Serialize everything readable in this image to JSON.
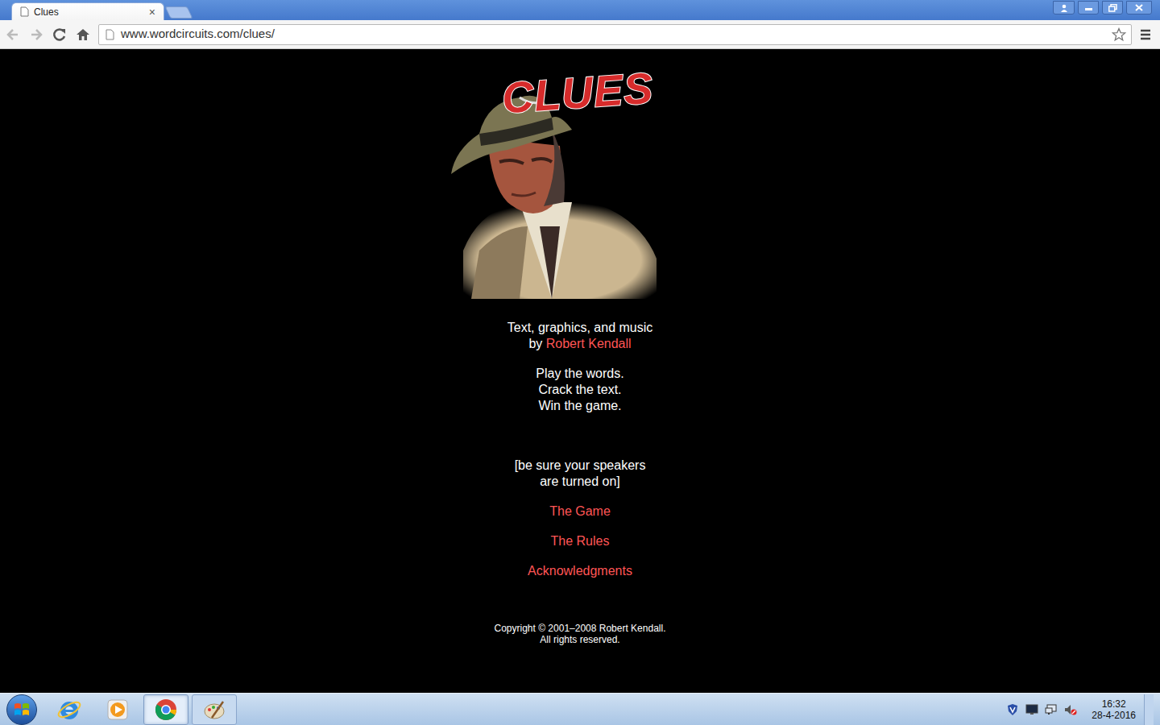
{
  "window": {
    "title": "Clues"
  },
  "browser": {
    "tabs": [
      {
        "label": "Clues",
        "selected": true,
        "close": "×"
      },
      {
        "label": "",
        "selected": false
      }
    ],
    "address": "www.wordcircuits.com/clues/"
  },
  "page": {
    "logo": "CLUES",
    "credit": "Text, graphics, and music",
    "by_line": {
      "prefix": "by",
      "author": "Robert Kendall"
    },
    "tagline": [
      "Play the words.",
      "Crack the text.",
      "Win the game."
    ],
    "notice": [
      "[be sure your speakers",
      "are turned on]"
    ],
    "links": [
      "The Game",
      "The Rules",
      "Acknowledgments"
    ],
    "copyright": [
      "Copyright © 2001–2008 Robert Kendall.",
      "All rights reserved."
    ]
  },
  "taskbar": {
    "apps": [
      {
        "kind": "ie",
        "selected": false,
        "running": false
      },
      {
        "kind": "media",
        "selected": false,
        "running": false
      },
      {
        "kind": "chrome",
        "selected": true,
        "running": true
      },
      {
        "kind": "paint",
        "selected": false,
        "running": true
      }
    ],
    "tray": [
      {
        "kind": "shield"
      },
      {
        "kind": "monitor"
      },
      {
        "kind": "network"
      },
      {
        "kind": "speaker-muted"
      }
    ],
    "clock": {
      "time": "16:32",
      "date": "28-4-2016"
    }
  }
}
